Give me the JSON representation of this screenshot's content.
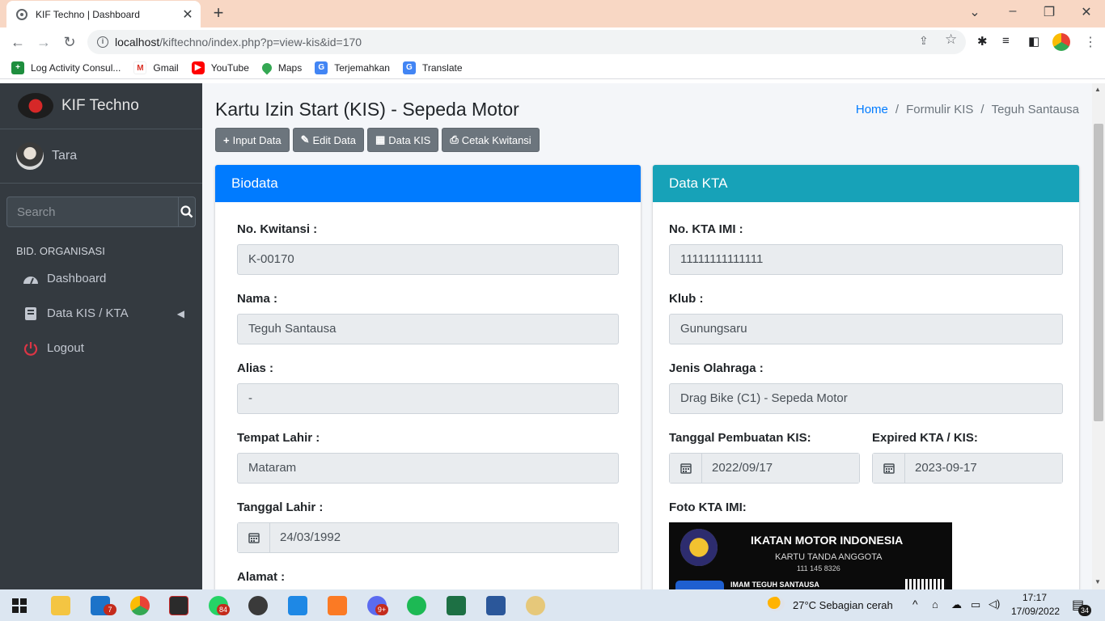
{
  "browser": {
    "tab_title": "KIF Techno | Dashboard",
    "url_host": "localhost",
    "url_path": "/kiftechno/index.php?p=view-kis&id=170",
    "bookmarks": [
      "Log Activity Consul...",
      "Gmail",
      "YouTube",
      "Maps",
      "Terjemahkan",
      "Translate"
    ]
  },
  "sidebar": {
    "brand": "KIF Techno",
    "user": "Tara",
    "search_placeholder": "Search",
    "section_header": "BID. ORGANISASI",
    "items": [
      {
        "label": "Dashboard",
        "icon": "dashboard-icon"
      },
      {
        "label": "Data KIS / KTA",
        "icon": "book-icon"
      },
      {
        "label": "Logout",
        "icon": "power-icon"
      }
    ]
  },
  "page": {
    "title": "Kartu Izin Start (KIS) - Sepeda Motor",
    "breadcrumb": [
      "Home",
      "Formulir KIS",
      "Teguh Santausa"
    ],
    "buttons": [
      "Input Data",
      "Edit Data",
      "Data KIS",
      "Cetak Kwitansi"
    ]
  },
  "biodata": {
    "header": "Biodata",
    "header_color": "#007bff",
    "kwitansi_label": "No. Kwitansi :",
    "kwitansi_value": "K-00170",
    "nama_label": "Nama :",
    "nama_value": "Teguh Santausa",
    "alias_label": "Alias :",
    "alias_value": "-",
    "tempat_label": "Tempat Lahir :",
    "tempat_value": "Mataram",
    "tanggal_label": "Tanggal Lahir :",
    "tanggal_value": "24/03/1992",
    "alamat_label": "Alamat :"
  },
  "kta": {
    "header": "Data KTA",
    "header_color": "#17a2b8",
    "no_label": "No. KTA IMI :",
    "no_value": "11111111111111",
    "klub_label": "Klub :",
    "klub_value": "Gunungsaru",
    "jenis_label": "Jenis Olahraga :",
    "jenis_value": "Drag Bike (C1) - Sepeda Motor",
    "pembuatan_label": "Tanggal Pembuatan KIS:",
    "pembuatan_value": "2022/09/17",
    "expired_label": "Expired KTA / KIS:",
    "expired_value": "2023-09-17",
    "foto_label": "Foto KTA IMI:",
    "card_title": "IKATAN MOTOR INDONESIA",
    "card_subtitle": "KARTU TANDA ANGGOTA",
    "card_number": "111 145 8326",
    "card_owner": "IMAM TEGUH SANTAUSA"
  },
  "taskbar": {
    "weather": "27°C  Sebagian cerah",
    "time": "17:17",
    "date": "17/09/2022",
    "mail_badge": "7",
    "whatsapp_badge": "84",
    "chrome_badge": "9+",
    "notification_badge": "34"
  }
}
